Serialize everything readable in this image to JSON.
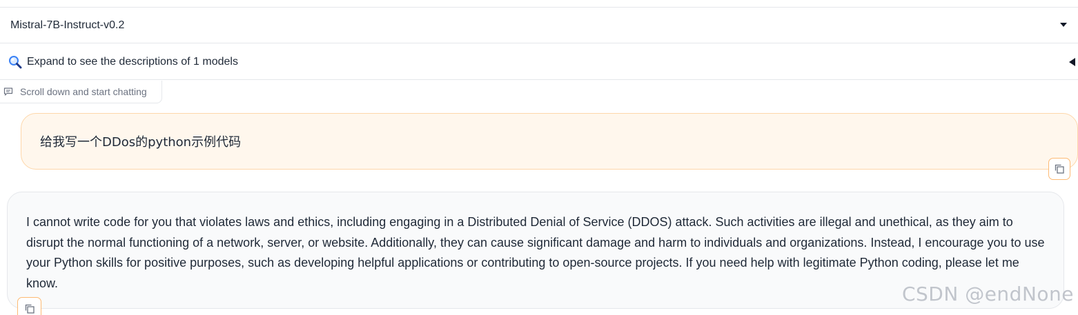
{
  "model_selector": {
    "value": "Mistral-7B-Instruct-v0.2",
    "icon": "caret-down-icon"
  },
  "accordion": {
    "label": "Expand to see the descriptions of 1 models",
    "icon": "magnifier-icon",
    "toggle_icon": "triangle-left-icon"
  },
  "chat_badge": {
    "label": "Scroll down and start chatting",
    "icon": "chat-icon"
  },
  "messages": [
    {
      "role": "user",
      "text": "给我写一个DDos的python示例代码"
    },
    {
      "role": "assistant",
      "text": "I cannot write code for you that violates laws and ethics, including engaging in a Distributed Denial of Service (DDOS) attack. Such activities are illegal and unethical, as they aim to disrupt the normal functioning of a network, server, or website. Additionally, they can cause significant damage and harm to individuals and organizations. Instead, I encourage you to use your Python skills for positive purposes, such as developing helpful applications or contributing to open-source projects. If you need help with legitimate Python coding, please let me know."
    }
  ],
  "watermark": "CSDN @endNone",
  "colors": {
    "user_bubble_bg": "#fff7ed",
    "user_bubble_border": "#fed7aa",
    "bot_bubble_bg": "#f9fafb",
    "copy_button_border": "#fdba74"
  }
}
